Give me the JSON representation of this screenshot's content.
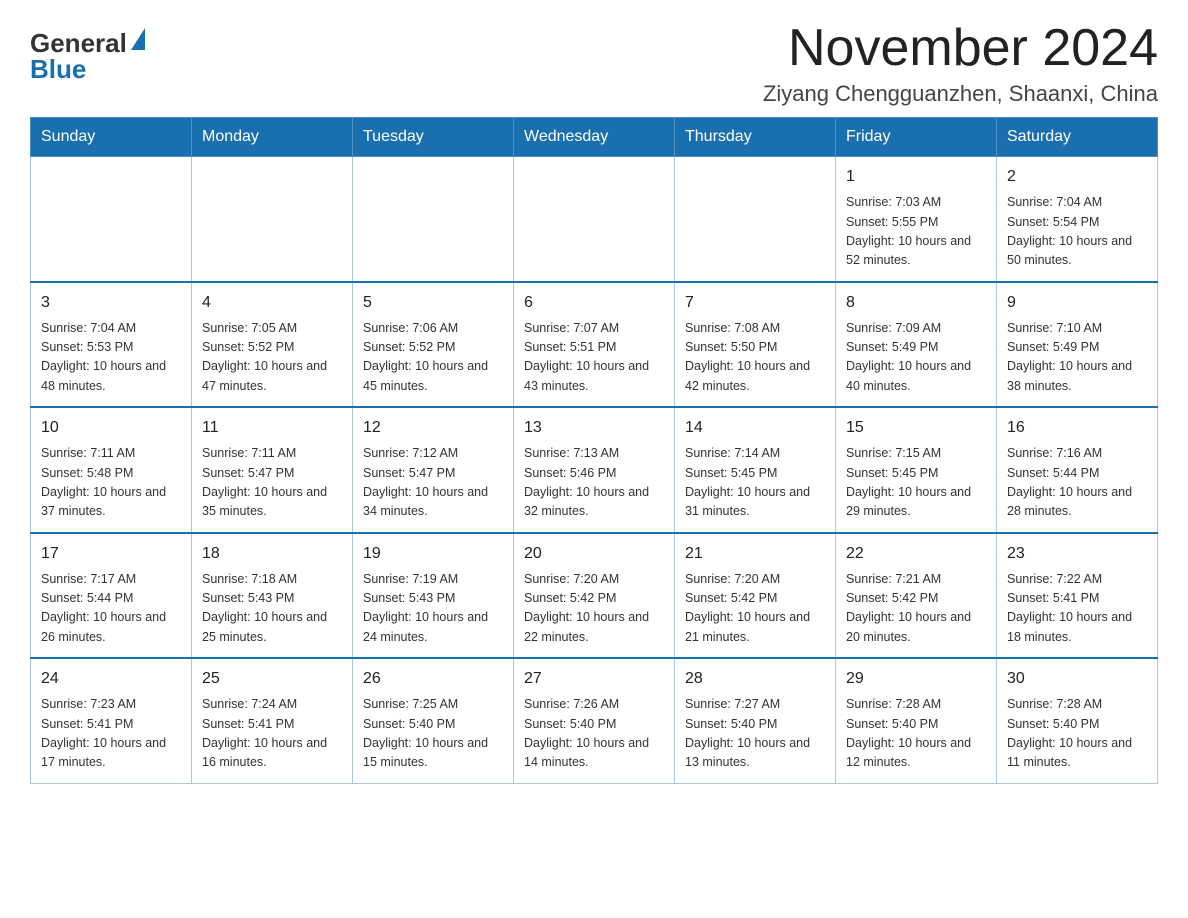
{
  "logo": {
    "general": "General",
    "blue": "Blue"
  },
  "header": {
    "month": "November 2024",
    "location": "Ziyang Chengguanzhen, Shaanxi, China"
  },
  "days_of_week": [
    "Sunday",
    "Monday",
    "Tuesday",
    "Wednesday",
    "Thursday",
    "Friday",
    "Saturday"
  ],
  "weeks": [
    [
      {
        "day": "",
        "info": ""
      },
      {
        "day": "",
        "info": ""
      },
      {
        "day": "",
        "info": ""
      },
      {
        "day": "",
        "info": ""
      },
      {
        "day": "",
        "info": ""
      },
      {
        "day": "1",
        "info": "Sunrise: 7:03 AM\nSunset: 5:55 PM\nDaylight: 10 hours and 52 minutes."
      },
      {
        "day": "2",
        "info": "Sunrise: 7:04 AM\nSunset: 5:54 PM\nDaylight: 10 hours and 50 minutes."
      }
    ],
    [
      {
        "day": "3",
        "info": "Sunrise: 7:04 AM\nSunset: 5:53 PM\nDaylight: 10 hours and 48 minutes."
      },
      {
        "day": "4",
        "info": "Sunrise: 7:05 AM\nSunset: 5:52 PM\nDaylight: 10 hours and 47 minutes."
      },
      {
        "day": "5",
        "info": "Sunrise: 7:06 AM\nSunset: 5:52 PM\nDaylight: 10 hours and 45 minutes."
      },
      {
        "day": "6",
        "info": "Sunrise: 7:07 AM\nSunset: 5:51 PM\nDaylight: 10 hours and 43 minutes."
      },
      {
        "day": "7",
        "info": "Sunrise: 7:08 AM\nSunset: 5:50 PM\nDaylight: 10 hours and 42 minutes."
      },
      {
        "day": "8",
        "info": "Sunrise: 7:09 AM\nSunset: 5:49 PM\nDaylight: 10 hours and 40 minutes."
      },
      {
        "day": "9",
        "info": "Sunrise: 7:10 AM\nSunset: 5:49 PM\nDaylight: 10 hours and 38 minutes."
      }
    ],
    [
      {
        "day": "10",
        "info": "Sunrise: 7:11 AM\nSunset: 5:48 PM\nDaylight: 10 hours and 37 minutes."
      },
      {
        "day": "11",
        "info": "Sunrise: 7:11 AM\nSunset: 5:47 PM\nDaylight: 10 hours and 35 minutes."
      },
      {
        "day": "12",
        "info": "Sunrise: 7:12 AM\nSunset: 5:47 PM\nDaylight: 10 hours and 34 minutes."
      },
      {
        "day": "13",
        "info": "Sunrise: 7:13 AM\nSunset: 5:46 PM\nDaylight: 10 hours and 32 minutes."
      },
      {
        "day": "14",
        "info": "Sunrise: 7:14 AM\nSunset: 5:45 PM\nDaylight: 10 hours and 31 minutes."
      },
      {
        "day": "15",
        "info": "Sunrise: 7:15 AM\nSunset: 5:45 PM\nDaylight: 10 hours and 29 minutes."
      },
      {
        "day": "16",
        "info": "Sunrise: 7:16 AM\nSunset: 5:44 PM\nDaylight: 10 hours and 28 minutes."
      }
    ],
    [
      {
        "day": "17",
        "info": "Sunrise: 7:17 AM\nSunset: 5:44 PM\nDaylight: 10 hours and 26 minutes."
      },
      {
        "day": "18",
        "info": "Sunrise: 7:18 AM\nSunset: 5:43 PM\nDaylight: 10 hours and 25 minutes."
      },
      {
        "day": "19",
        "info": "Sunrise: 7:19 AM\nSunset: 5:43 PM\nDaylight: 10 hours and 24 minutes."
      },
      {
        "day": "20",
        "info": "Sunrise: 7:20 AM\nSunset: 5:42 PM\nDaylight: 10 hours and 22 minutes."
      },
      {
        "day": "21",
        "info": "Sunrise: 7:20 AM\nSunset: 5:42 PM\nDaylight: 10 hours and 21 minutes."
      },
      {
        "day": "22",
        "info": "Sunrise: 7:21 AM\nSunset: 5:42 PM\nDaylight: 10 hours and 20 minutes."
      },
      {
        "day": "23",
        "info": "Sunrise: 7:22 AM\nSunset: 5:41 PM\nDaylight: 10 hours and 18 minutes."
      }
    ],
    [
      {
        "day": "24",
        "info": "Sunrise: 7:23 AM\nSunset: 5:41 PM\nDaylight: 10 hours and 17 minutes."
      },
      {
        "day": "25",
        "info": "Sunrise: 7:24 AM\nSunset: 5:41 PM\nDaylight: 10 hours and 16 minutes."
      },
      {
        "day": "26",
        "info": "Sunrise: 7:25 AM\nSunset: 5:40 PM\nDaylight: 10 hours and 15 minutes."
      },
      {
        "day": "27",
        "info": "Sunrise: 7:26 AM\nSunset: 5:40 PM\nDaylight: 10 hours and 14 minutes."
      },
      {
        "day": "28",
        "info": "Sunrise: 7:27 AM\nSunset: 5:40 PM\nDaylight: 10 hours and 13 minutes."
      },
      {
        "day": "29",
        "info": "Sunrise: 7:28 AM\nSunset: 5:40 PM\nDaylight: 10 hours and 12 minutes."
      },
      {
        "day": "30",
        "info": "Sunrise: 7:28 AM\nSunset: 5:40 PM\nDaylight: 10 hours and 11 minutes."
      }
    ]
  ]
}
